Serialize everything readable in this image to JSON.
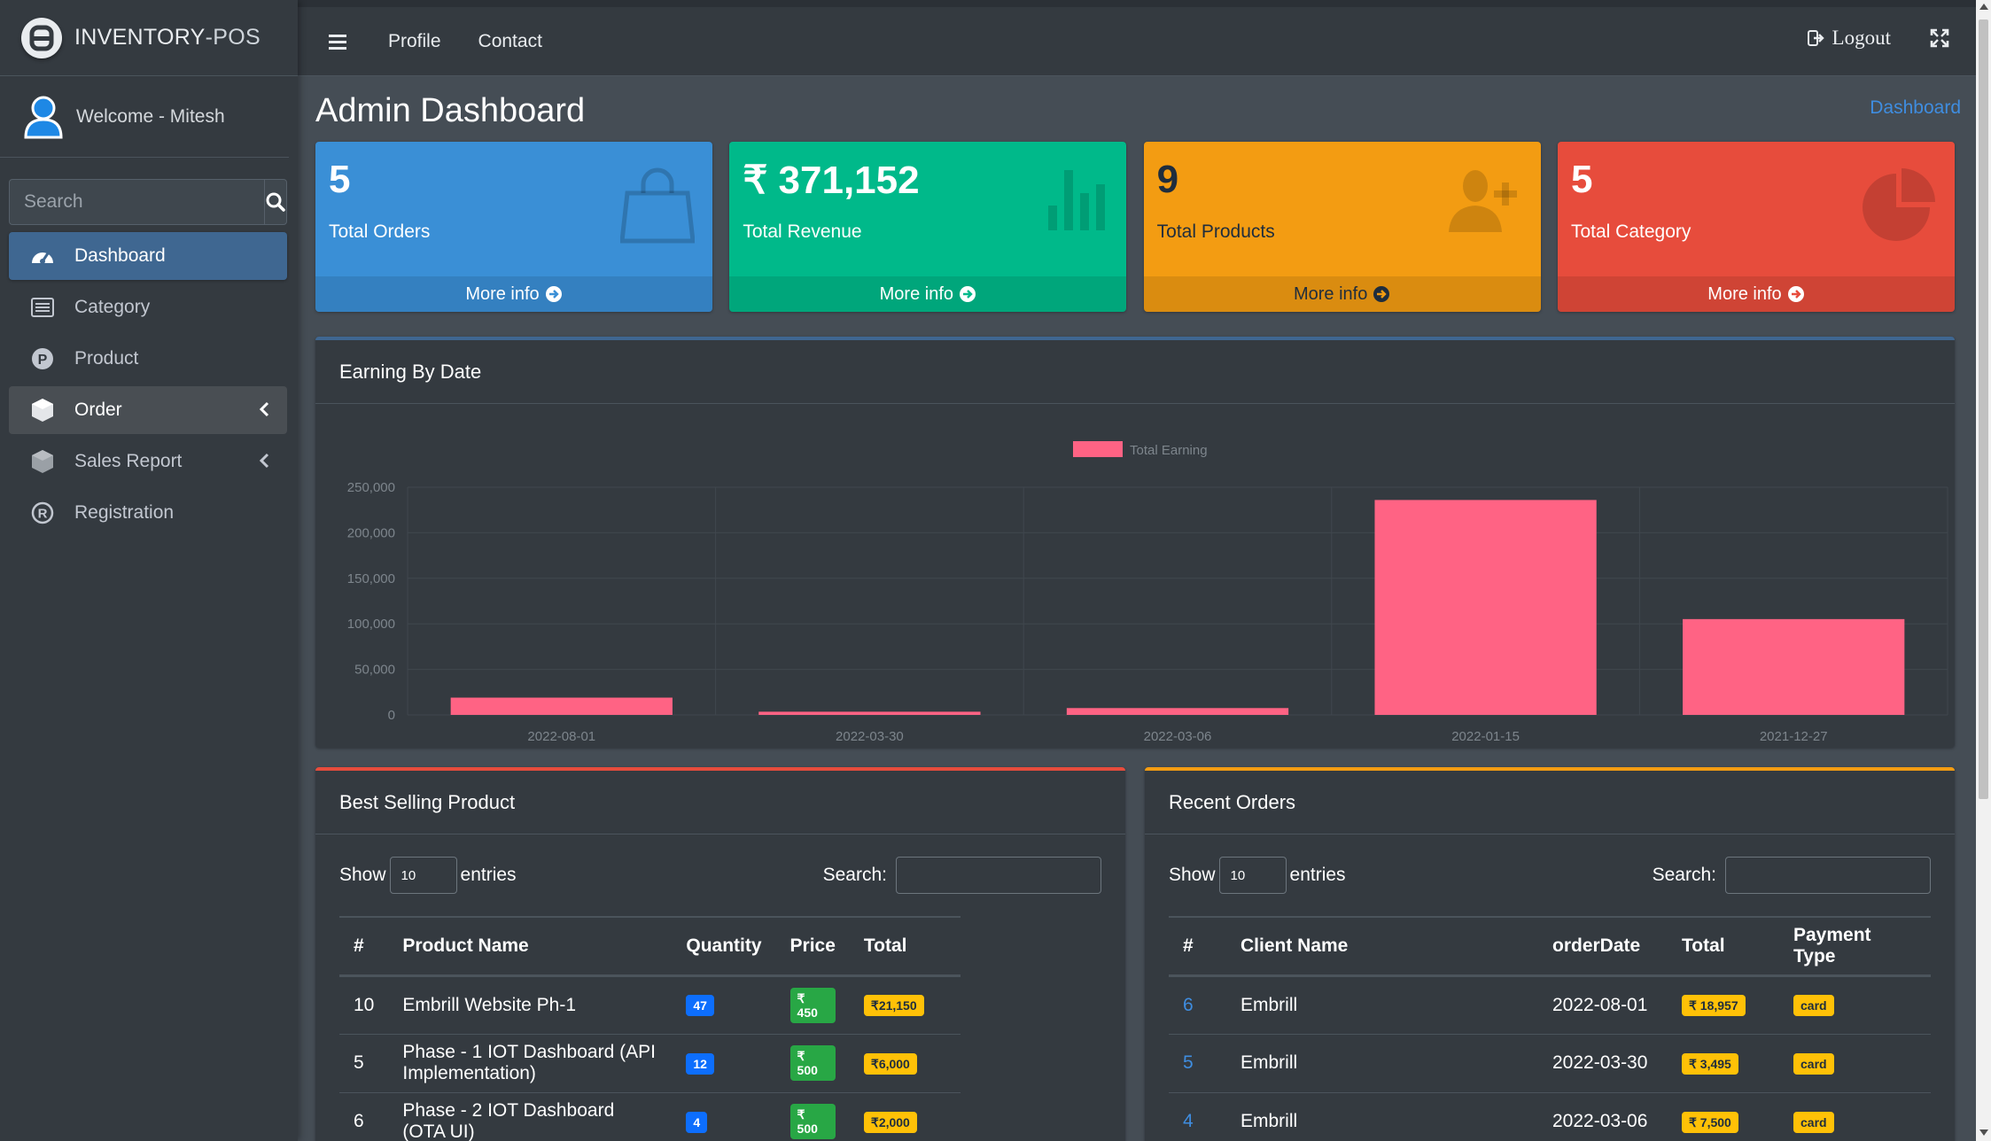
{
  "brand": {
    "name_main": "INVENTORY",
    "name_suffix": "-POS"
  },
  "user": {
    "welcome": "Welcome - Mitesh"
  },
  "sidebar": {
    "search_placeholder": "Search",
    "items": [
      {
        "label": "Dashboard",
        "icon": "tachometer-icon",
        "active": true
      },
      {
        "label": "Category",
        "icon": "list-icon"
      },
      {
        "label": "Product",
        "icon": "product-p-icon"
      },
      {
        "label": "Order",
        "icon": "cube-icon",
        "expandable": true
      },
      {
        "label": "Sales Report",
        "icon": "cube-icon",
        "expandable": true
      },
      {
        "label": "Registration",
        "icon": "registered-icon"
      }
    ]
  },
  "topnav": {
    "links": [
      "Profile",
      "Contact"
    ],
    "logout": "Logout"
  },
  "page": {
    "title": "Admin Dashboard",
    "breadcrumb": "Dashboard"
  },
  "stat_boxes": [
    {
      "value": "5",
      "label": "Total Orders",
      "footer": "More info",
      "icon": "shopping-bag-icon",
      "color": "#3a8fd6"
    },
    {
      "value": "₹ 371,152",
      "label": "Total Revenue",
      "footer": "More info",
      "icon": "bar-chart-icon",
      "color": "#00b98a"
    },
    {
      "value": "9",
      "label": "Total Products",
      "footer": "More info",
      "icon": "user-plus-icon",
      "color": "#f39c12"
    },
    {
      "value": "5",
      "label": "Total Category",
      "footer": "More info",
      "icon": "pie-chart-icon",
      "color": "#e74c3c"
    }
  ],
  "chart_card": {
    "title": "Earning By Date"
  },
  "chart_data": {
    "type": "bar",
    "categories": [
      "2022-08-01",
      "2022-03-30",
      "2022-03-06",
      "2022-01-15",
      "2021-12-27"
    ],
    "series": [
      {
        "name": "Total Earning",
        "values": [
          18957,
          3495,
          7500,
          236000,
          105200
        ],
        "color": "#ff6384"
      }
    ],
    "ylim": [
      0,
      250000
    ],
    "yticks": [
      0,
      50000,
      100000,
      150000,
      200000,
      250000
    ],
    "ytick_labels": [
      "0",
      "50,000",
      "100,000",
      "150,000",
      "200,000",
      "250,000"
    ],
    "legend": "top-center",
    "grid": true
  },
  "best_selling": {
    "title": "Best Selling Product",
    "show": "Show",
    "entries": "entries",
    "length_value": "10",
    "search_label": "Search:",
    "columns": [
      "#",
      "Product Name",
      "Quantity",
      "Price",
      "Total"
    ],
    "rows": [
      {
        "id": "10",
        "name": "Embrill Website Ph-1",
        "qty": "47",
        "price": "₹ 450",
        "total": "₹21,150"
      },
      {
        "id": "5",
        "name": "Phase - 1 IOT Dashboard (API Implementation)",
        "qty": "12",
        "price": "₹ 500",
        "total": "₹6,000"
      },
      {
        "id": "6",
        "name": "Phase - 2 IOT Dashboard (OTA UI)",
        "qty": "4",
        "price": "₹ 500",
        "total": "₹2,000"
      }
    ]
  },
  "recent_orders": {
    "title": "Recent Orders",
    "show": "Show",
    "entries": "entries",
    "length_value": "10",
    "search_label": "Search:",
    "columns": [
      "#",
      "Client Name",
      "orderDate",
      "Total",
      "Payment Type"
    ],
    "rows": [
      {
        "id": "6",
        "client": "Embrill",
        "date": "2022-08-01",
        "total": "₹ 18,957",
        "payment": "card"
      },
      {
        "id": "5",
        "client": "Embrill",
        "date": "2022-03-30",
        "total": "₹ 3,495",
        "payment": "card"
      },
      {
        "id": "4",
        "client": "Embrill",
        "date": "2022-03-06",
        "total": "₹ 7,500",
        "payment": "card"
      }
    ]
  }
}
